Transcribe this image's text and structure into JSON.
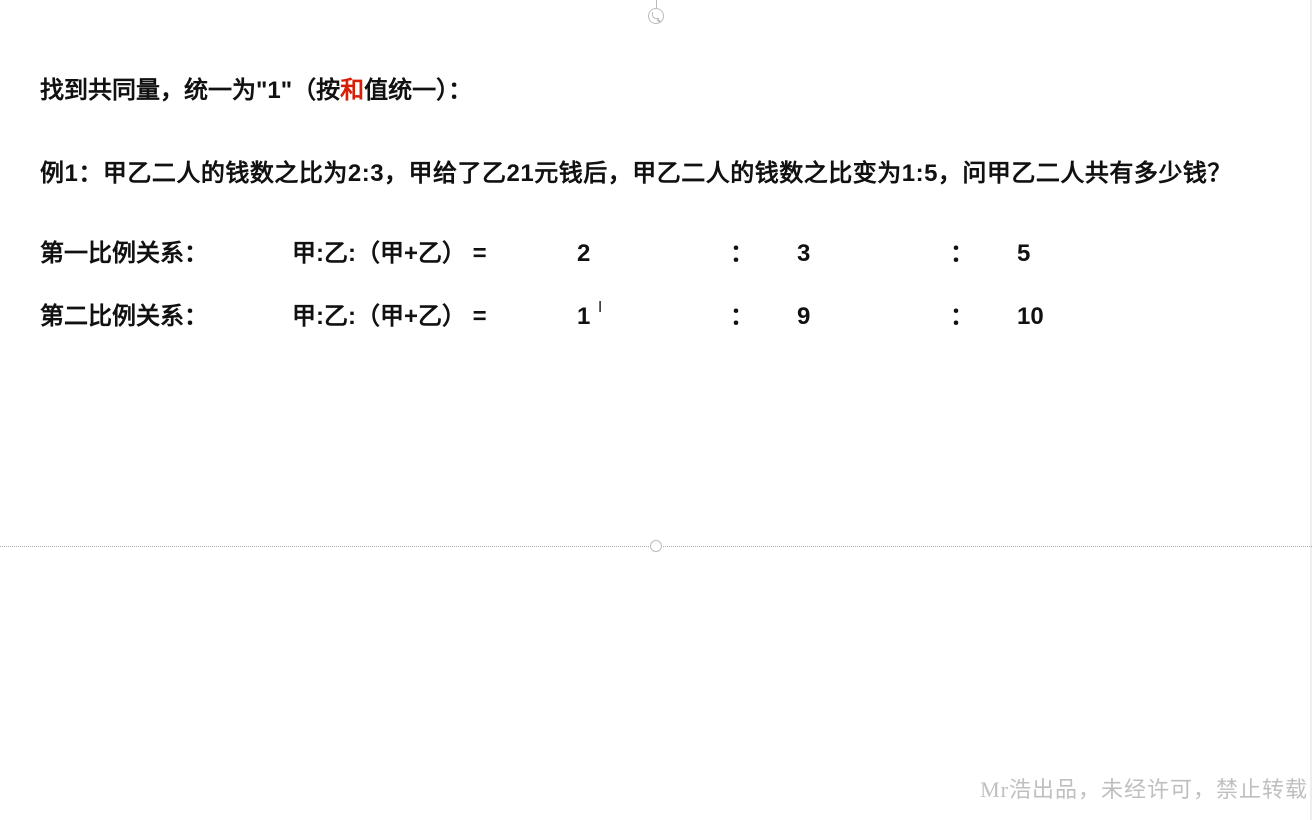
{
  "heading": {
    "prefix": "找到共同量，统一为\"1\"（按",
    "highlight": "和",
    "suffix": "值统一）："
  },
  "example": {
    "label": "例1：",
    "text": "甲乙二人的钱数之比为2:3，甲给了乙21元钱后，甲乙二人的钱数之比变为1:5，问甲乙二人共有多少钱？"
  },
  "ratio1": {
    "label": "第一比例关系：",
    "expr": "甲:乙:（甲+乙） =",
    "a": "2",
    "b": "3",
    "c": "5"
  },
  "ratio2": {
    "label": "第二比例关系：",
    "expr": "甲:乙:（甲+乙） =",
    "a": "1",
    "b": "9",
    "c": "10"
  },
  "colon": "：",
  "footer": "Mr浩出品，未经许可，禁止转载"
}
